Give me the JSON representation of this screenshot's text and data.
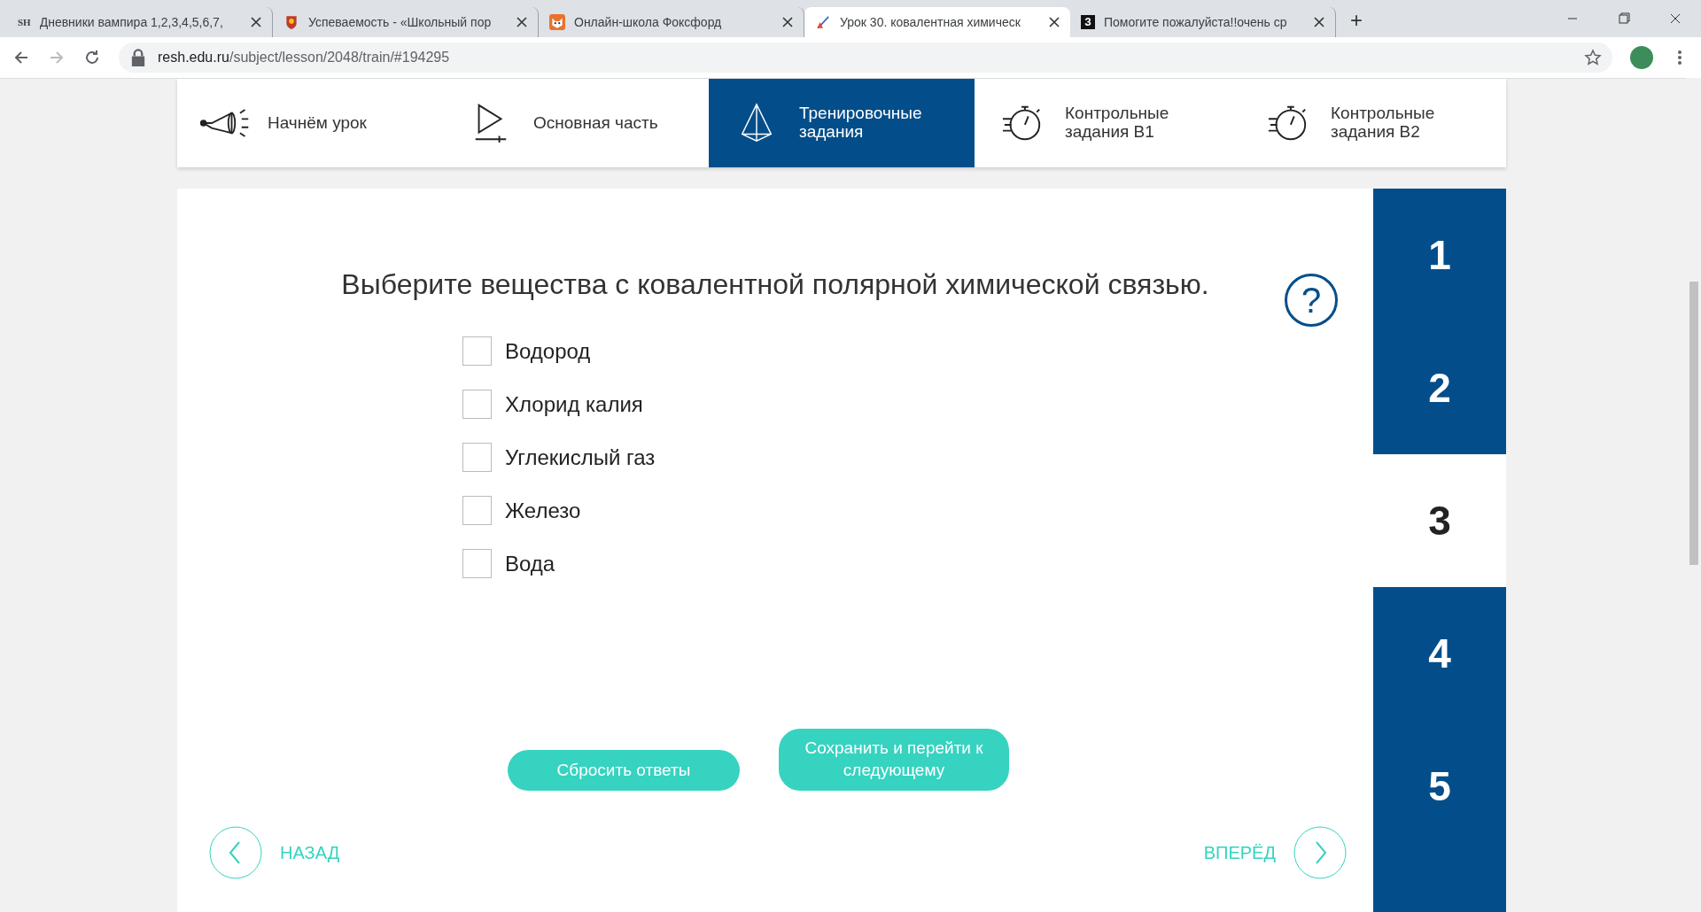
{
  "browser": {
    "tabs": [
      {
        "title": "Дневники вампира 1,2,3,4,5,6,7,",
        "selected": false,
        "kind": "sh"
      },
      {
        "title": "Успеваемость - «Школьный пор",
        "selected": false,
        "kind": "crest"
      },
      {
        "title": "Онлайн-школа Фоксфорд",
        "selected": false,
        "kind": "fox"
      },
      {
        "title": "Урок 30. ковалентная химическ",
        "selected": true,
        "kind": "resh"
      },
      {
        "title": "Помогите пожалуйста!!очень ср",
        "selected": false,
        "kind": "z"
      }
    ],
    "favicon_sh": "SH",
    "favicon_z": "З",
    "new_tab": "+",
    "url_host": "resh.edu.ru",
    "url_path": "/subject/lesson/2048/train/#194295"
  },
  "lesson_nav": [
    {
      "label": "Начнём урок",
      "kind": "horn",
      "selected": false
    },
    {
      "label": "Основная часть",
      "kind": "play",
      "selected": false
    },
    {
      "label": "Тренировочные задания",
      "kind": "pyramid",
      "selected": true
    },
    {
      "label": "Контрольные задания В1",
      "kind": "timer",
      "selected": false
    },
    {
      "label": "Контрольные задания В2",
      "kind": "timer",
      "selected": false
    }
  ],
  "question": "Выберите вещества с ковалентной полярной химической связью.",
  "help": "?",
  "options": [
    {
      "label": "Водород",
      "checked": false
    },
    {
      "label": "Хлорид калия",
      "checked": false
    },
    {
      "label": "Углекислый газ",
      "checked": false
    },
    {
      "label": "Железо",
      "checked": false
    },
    {
      "label": "Вода",
      "checked": false
    }
  ],
  "buttons": {
    "reset": "Сбросить ответы",
    "save": "Сохранить и перейти к следующему"
  },
  "pager": {
    "back": "НАЗАД",
    "forward": "ВПЕРЁД"
  },
  "task_numbers": [
    {
      "label": "1",
      "selected": false
    },
    {
      "label": "2",
      "selected": false
    },
    {
      "label": "3",
      "selected": true
    },
    {
      "label": "4",
      "selected": false
    },
    {
      "label": "5",
      "selected": false
    }
  ]
}
